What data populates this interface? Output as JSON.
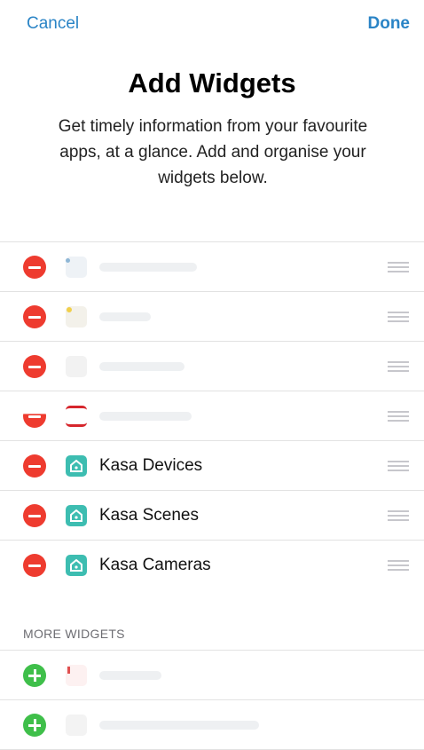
{
  "nav": {
    "cancel": "Cancel",
    "done": "Done"
  },
  "header": {
    "title": "Add Widgets",
    "subtitle": "Get timely information from your favourite apps, at a glance. Add and organise your widgets below."
  },
  "active_widgets": [
    {
      "label": "",
      "icon": "blurred-weather-icon"
    },
    {
      "label": "",
      "icon": "blurred-notes-icon"
    },
    {
      "label": "",
      "icon": "blurred-app-icon"
    },
    {
      "label": "",
      "icon": "blurred-app-icon"
    },
    {
      "label": "Kasa Devices",
      "icon": "kasa-icon"
    },
    {
      "label": "Kasa Scenes",
      "icon": "kasa-icon"
    },
    {
      "label": "Kasa Cameras",
      "icon": "kasa-icon"
    }
  ],
  "more_widgets": {
    "title": "MORE WIDGETS",
    "items": [
      {
        "label": "",
        "icon": "blurred-app-icon"
      },
      {
        "label": "",
        "icon": "blurred-app-icon"
      }
    ]
  },
  "colors": {
    "accent": "#2a84c6",
    "remove": "#ee3b2f",
    "add": "#3fbf4a",
    "kasa": "#3dbdb1"
  }
}
